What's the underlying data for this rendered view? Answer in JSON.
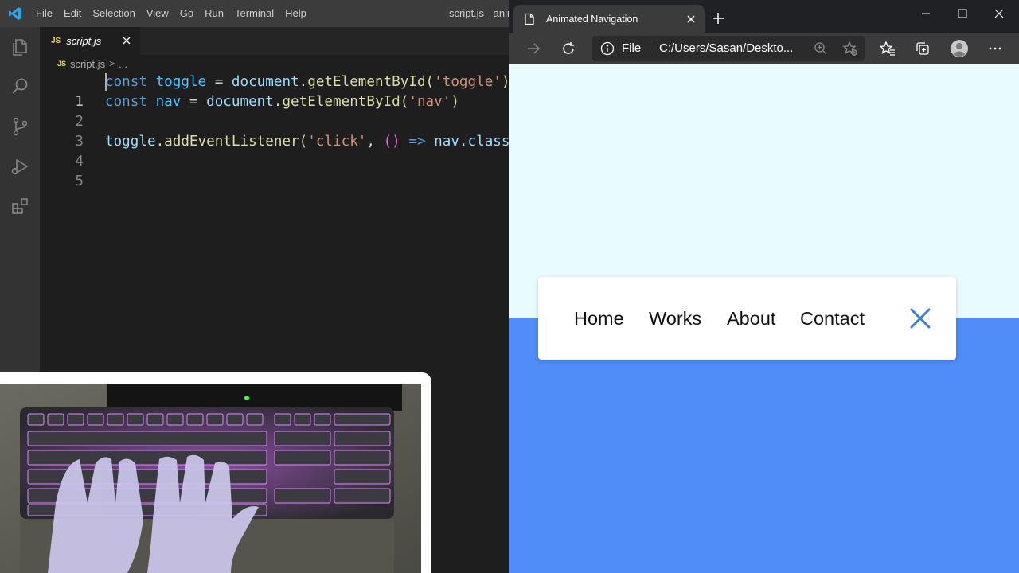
{
  "vscode": {
    "menu": [
      "File",
      "Edit",
      "Selection",
      "View",
      "Go",
      "Run",
      "Terminal",
      "Help"
    ],
    "window_title": "script.js - anim",
    "activity_icons": [
      "explorer-icon",
      "search-icon",
      "source-control-icon",
      "run-debug-icon",
      "extensions-icon"
    ],
    "tab": {
      "badge": "JS",
      "name": "script.js"
    },
    "breadcrumb": {
      "badge": "JS",
      "file": "script.js",
      "separator": ">",
      "more": "..."
    },
    "line_numbers": [
      "1",
      "2",
      "3",
      "4",
      "5"
    ],
    "code": {
      "l1": {
        "kw": "const",
        "var": "toggle",
        "eq": "=",
        "obj": "document",
        "dot": ".",
        "fn": "getElementById",
        "open": "(",
        "str": "'toggle'",
        "close": ")"
      },
      "l2": {
        "kw": "const",
        "var": "nav",
        "eq": "=",
        "obj": "document",
        "dot": ".",
        "fn": "getElementById",
        "open": "(",
        "str": "'nav'",
        "close": ")"
      },
      "l4": {
        "obj": "toggle",
        "dot": ".",
        "fn": "addEventListener",
        "open": "(",
        "str": "'click'",
        "comma": ",",
        "arrowparens": "()",
        "arrow": "=>",
        "target": "nav",
        "dot2": ".",
        "prop": "classLi"
      }
    }
  },
  "browser": {
    "tab_title": "Animated Navigation",
    "address": {
      "scheme": "File",
      "url": "C:/Users/Sasan/Deskto..."
    },
    "toolbar_icons": [
      "forward-icon",
      "refresh-icon",
      "info-icon",
      "zoom-icon",
      "add-favorite-icon",
      "favorites-icon",
      "collections-icon",
      "profile-icon",
      "more-icon"
    ],
    "nav_links": [
      "Home",
      "Works",
      "About",
      "Contact"
    ],
    "colors": {
      "top_bg": "#e8fbff",
      "bottom_bg": "#508df8",
      "close_icon": "#3a7fd5"
    }
  }
}
